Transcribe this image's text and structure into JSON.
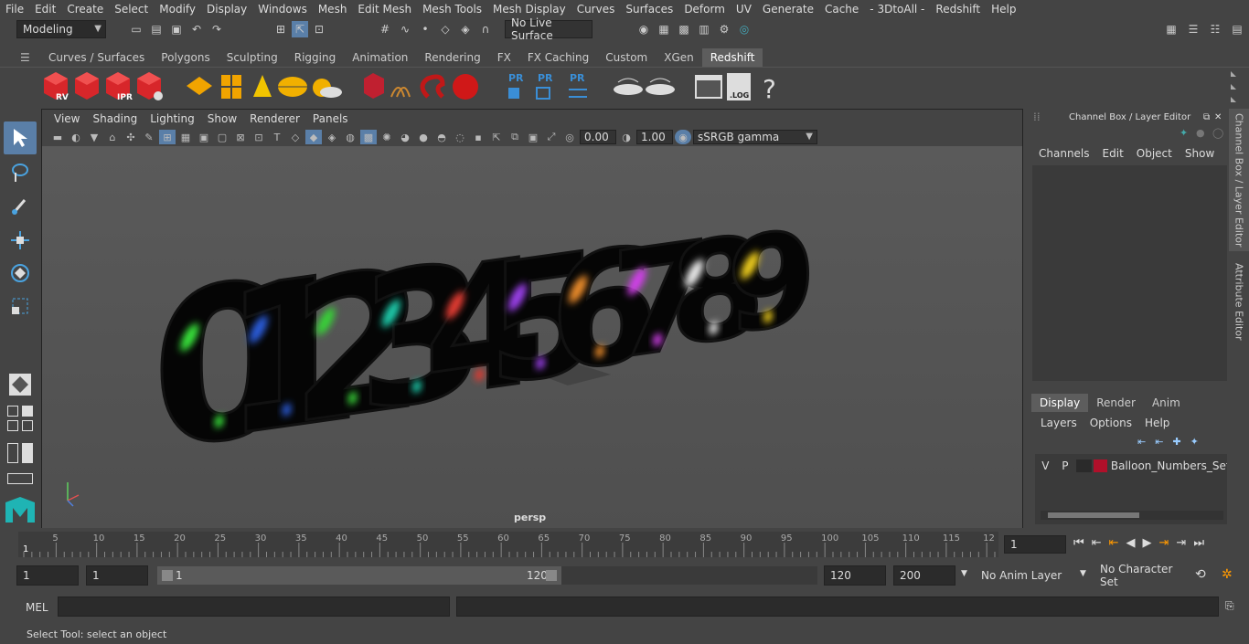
{
  "menubar": [
    "File",
    "Edit",
    "Create",
    "Select",
    "Modify",
    "Display",
    "Windows",
    "Mesh",
    "Edit Mesh",
    "Mesh Tools",
    "Mesh Display",
    "Curves",
    "Surfaces",
    "Deform",
    "UV",
    "Generate",
    "Cache",
    "- 3DtoAll -",
    "Redshift",
    "Help"
  ],
  "status": {
    "workspace": "Modeling",
    "live_surface": "No Live Surface"
  },
  "shelf_tabs": [
    "Curves / Surfaces",
    "Polygons",
    "Sculpting",
    "Rigging",
    "Animation",
    "Rendering",
    "FX",
    "FX Caching",
    "Custom",
    "XGen",
    "Redshift"
  ],
  "shelf_active": "Redshift",
  "shelf_labels": {
    "rv": "RV",
    "ipr": "IPR",
    "pr": "PR",
    "log": ".LOG",
    "help": "?"
  },
  "viewport": {
    "menu": [
      "View",
      "Shading",
      "Lighting",
      "Show",
      "Renderer",
      "Panels"
    ],
    "exposure": "0.00",
    "gamma": "1.00",
    "color_space": "sSRGB gamma",
    "camera_label": "persp",
    "digits": [
      "0",
      "1",
      "2",
      "3",
      "4",
      "5",
      "6",
      "7",
      "8",
      "9"
    ]
  },
  "channel_box": {
    "title": "Channel Box / Layer Editor",
    "menu": [
      "Channels",
      "Edit",
      "Object",
      "Show"
    ],
    "tabs": [
      "Display",
      "Render",
      "Anim"
    ],
    "layer_menu": [
      "Layers",
      "Options",
      "Help"
    ],
    "layer": {
      "v": "V",
      "p": "P",
      "name": "Balloon_Numbers_Set_",
      "color": "#b0102a"
    }
  },
  "side_tabs": [
    "Channel Box / Layer Editor",
    "Attribute Editor"
  ],
  "timeline": {
    "ticks": [
      "5",
      "10",
      "15",
      "20",
      "25",
      "30",
      "35",
      "40",
      "45",
      "50",
      "55",
      "60",
      "65",
      "70",
      "75",
      "80",
      "85",
      "90",
      "95",
      "100",
      "105",
      "110",
      "115",
      "12"
    ],
    "start_marker": "1",
    "current_frame": "1"
  },
  "range": {
    "start": "1",
    "anim_start": "1",
    "slider_start": "1",
    "slider_end": "120",
    "end": "120",
    "anim_end": "200",
    "anim_layer": "No Anim Layer",
    "char_set": "No Character Set"
  },
  "mel": {
    "label": "MEL"
  },
  "help_line": "Select Tool: select an object"
}
